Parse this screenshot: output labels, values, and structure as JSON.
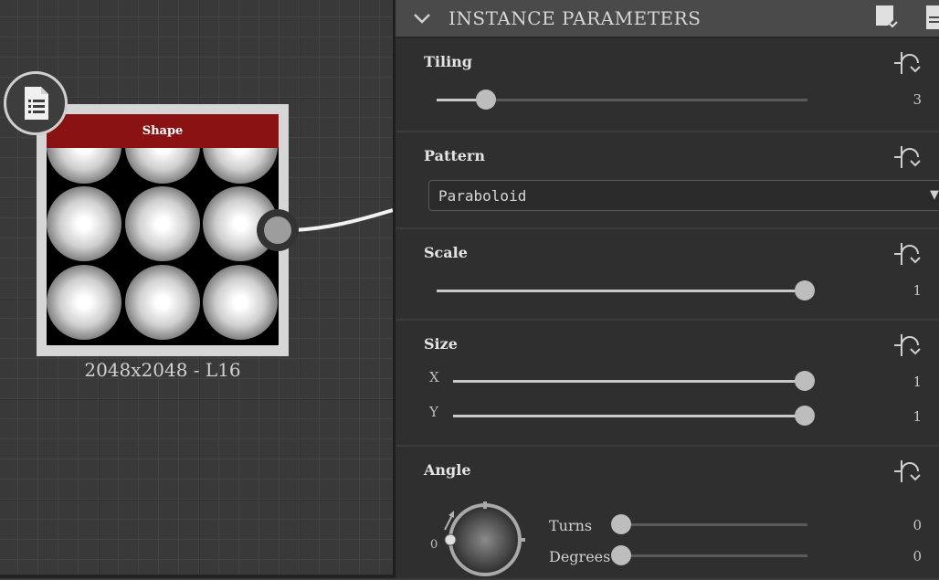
{
  "graph": {
    "node": {
      "title": "Shape",
      "resolution": "2048x2048 - L16",
      "icon": "document-list-icon",
      "title_color": "#8b1212"
    }
  },
  "panel": {
    "header": {
      "title": "INSTANCE PARAMETERS",
      "collapse_icon": "chevron-down-icon",
      "preset_icon": "bookmark-dropdown-icon",
      "doc_icon": "document-icon"
    },
    "tiling": {
      "label": "Tiling",
      "value": "3",
      "fraction": 0.13
    },
    "pattern": {
      "label": "Pattern",
      "selected": "Paraboloid"
    },
    "scale": {
      "label": "Scale",
      "value": "1",
      "fraction": 1.0
    },
    "size": {
      "label": "Size",
      "x_label": "X",
      "x_value": "1",
      "x_fraction": 1.0,
      "y_label": "Y",
      "y_value": "1",
      "y_fraction": 1.0
    },
    "angle": {
      "label": "Angle",
      "dial_zero": "0",
      "turns_label": "Turns",
      "turns_value": "0",
      "turns_fraction": 0.0,
      "degrees_label": "Degrees",
      "degrees_value": "0",
      "degrees_fraction": 0.0
    },
    "reset_icon": "reset-dropdown-icon"
  }
}
